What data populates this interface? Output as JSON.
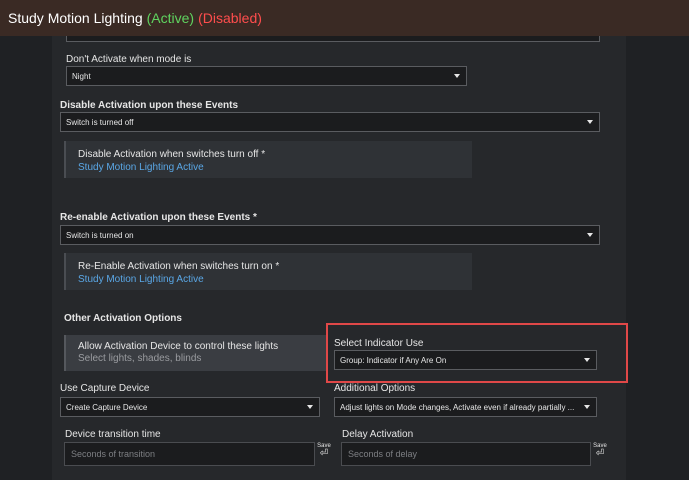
{
  "title": {
    "name": "Study Motion Lighting",
    "active": "(Active)",
    "disabled": "(Disabled)"
  },
  "dont_activate": {
    "label": "Don't Activate when mode is",
    "value": "Night"
  },
  "disable_events": {
    "label": "Disable Activation upon these Events",
    "value": "Switch is turned off",
    "card_title": "Disable Activation when switches turn off *",
    "card_link": "Study Motion Lighting Active"
  },
  "reenable_events": {
    "label": "Re-enable Activation upon these Events *",
    "value": "Switch is turned on",
    "card_title": "Re-Enable Activation when switches turn on *",
    "card_link": "Study Motion Lighting Active"
  },
  "other": {
    "heading": "Other Activation Options",
    "allow_title": "Allow Activation Device to control these lights",
    "allow_sub": "Select lights, shades, blinds"
  },
  "indicator": {
    "label": "Select Indicator Use",
    "value": "Group: Indicator if Any Are On"
  },
  "capture": {
    "label": "Use Capture Device",
    "value": "Create Capture Device"
  },
  "additional": {
    "label": "Additional Options",
    "value": "Adjust lights on Mode changes, Activate even if already partially ..."
  },
  "transition": {
    "label": "Device transition time",
    "placeholder": "Seconds of transition",
    "save": "Save",
    "save_glyph": "⏎"
  },
  "delay": {
    "label": "Delay Activation",
    "placeholder": "Seconds of delay",
    "save": "Save",
    "save_glyph": "⏎"
  },
  "colors": {
    "accent": "#5aa7e6",
    "active": "#5fd35f",
    "disabled": "#ff4d4d",
    "highlight": "#e04848"
  }
}
